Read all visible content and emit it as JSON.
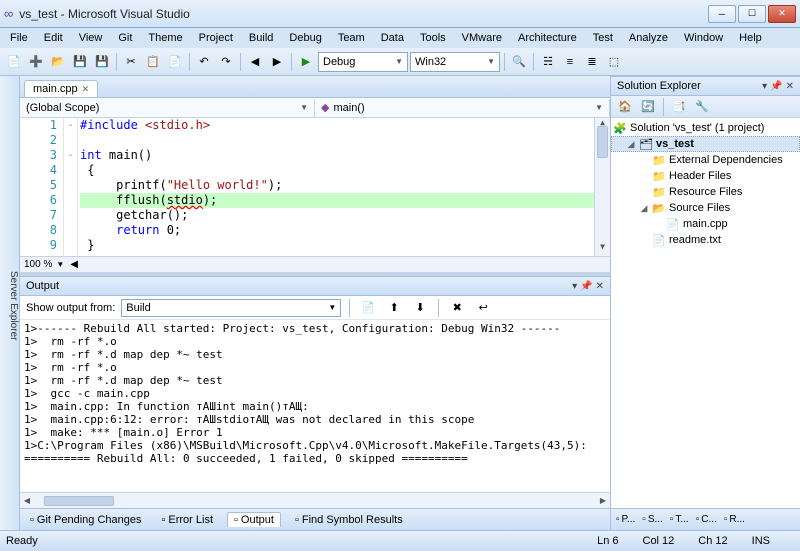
{
  "window": {
    "title": "vs_test - Microsoft Visual Studio"
  },
  "menus": [
    "File",
    "Edit",
    "View",
    "Git",
    "Theme",
    "Project",
    "Build",
    "Debug",
    "Team",
    "Data",
    "Tools",
    "VMware",
    "Architecture",
    "Test",
    "Analyze",
    "Window",
    "Help"
  ],
  "toolbar": {
    "config": "Debug",
    "platform": "Win32"
  },
  "editor": {
    "tab": "main.cpp",
    "scope": "(Global Scope)",
    "member": "main()",
    "zoom": "100 %",
    "lines": [
      {
        "n": "1",
        "html": "<span class='kw'>#include</span> <span class='inc'>&lt;stdio.h&gt;</span>",
        "outline": "-"
      },
      {
        "n": "2",
        "html": "",
        "outline": ""
      },
      {
        "n": "3",
        "html": "<span class='kw'>int</span> main()",
        "outline": "-"
      },
      {
        "n": "4",
        "html": " {",
        "outline": ""
      },
      {
        "n": "5",
        "html": "     printf(<span class='str'>\"Hello world!\"</span>);",
        "outline": ""
      },
      {
        "n": "6",
        "html": "     fflush(<span class='err'>stdio</span>);",
        "outline": "",
        "hl": true
      },
      {
        "n": "7",
        "html": "     getchar();",
        "outline": ""
      },
      {
        "n": "8",
        "html": "     <span class='kw'>return</span> 0;",
        "outline": ""
      },
      {
        "n": "9",
        "html": " }",
        "outline": ""
      }
    ]
  },
  "output": {
    "title": "Output",
    "from_label": "Show output from:",
    "from_value": "Build",
    "lines": [
      "1>------ Rebuild All started: Project: vs_test, Configuration: Debug Win32 ------",
      "1>  rm -rf *.o",
      "1>  rm -rf *.d map dep *~ test",
      "1>  rm -rf *.o",
      "1>  rm -rf *.d map dep *~ test",
      "1>  gcc -c main.cpp",
      "1>  main.cpp: In function тАШint main()тАЩ:",
      "1>  main.cpp:6:12: error: тАШstdioтАЩ was not declared in this scope",
      "1>  make: *** [main.o] Error 1",
      "1>C:\\Program Files (x86)\\MSBuild\\Microsoft.Cpp\\v4.0\\Microsoft.MakeFile.Targets(43,5):",
      "========== Rebuild All: 0 succeeded, 1 failed, 0 skipped =========="
    ]
  },
  "bottomtabs": [
    {
      "icon": "git-icon",
      "label": "Git Pending Changes"
    },
    {
      "icon": "error-list-icon",
      "label": "Error List"
    },
    {
      "icon": "output-icon",
      "label": "Output",
      "active": true
    },
    {
      "icon": "find-symbol-icon",
      "label": "Find Symbol Results"
    }
  ],
  "solutionExplorer": {
    "title": "Solution Explorer",
    "root": "Solution 'vs_test' (1 project)",
    "project": "vs_test",
    "folders": [
      "External Dependencies",
      "Header Files",
      "Resource Files"
    ],
    "sourceFolder": "Source Files",
    "sourceFile": "main.cpp",
    "looseFile": "readme.txt"
  },
  "rightTabs": [
    "P...",
    "S...",
    "T...",
    "C...",
    "R..."
  ],
  "status": {
    "ready": "Ready",
    "ln": "Ln 6",
    "col": "Col 12",
    "ch": "Ch 12",
    "ins": "INS"
  }
}
